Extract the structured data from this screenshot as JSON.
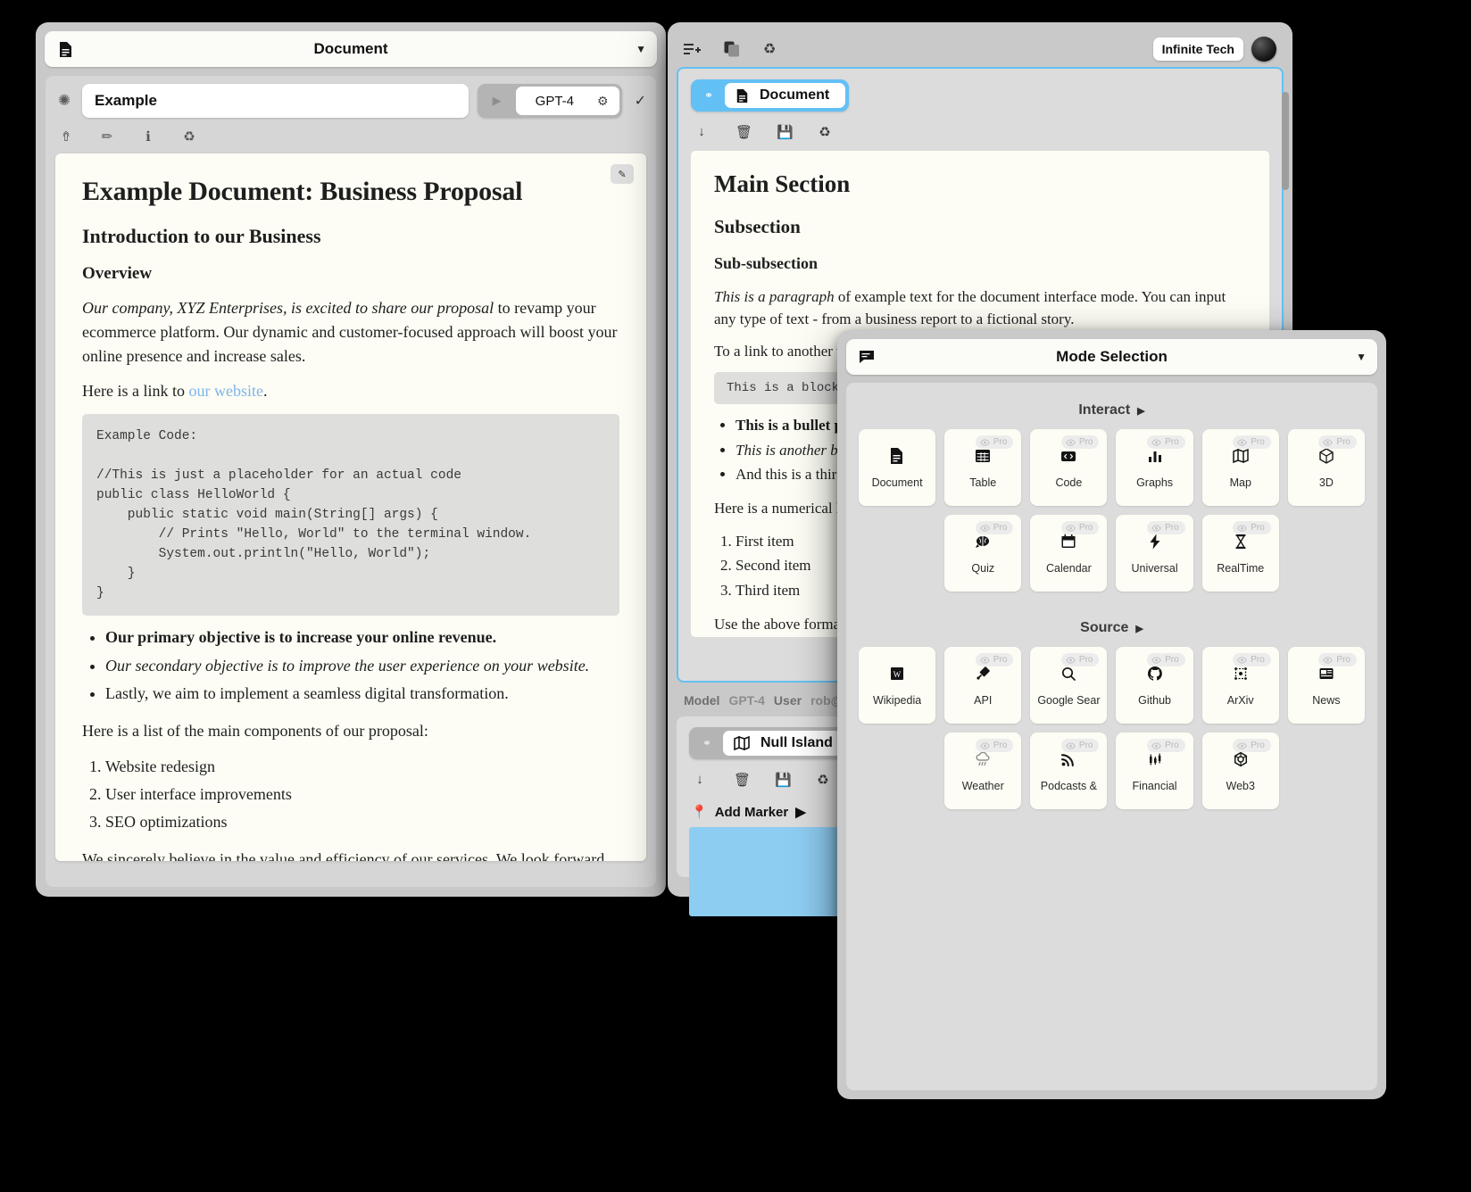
{
  "left_window": {
    "titlebar": {
      "title": "Document",
      "icon": "document-icon",
      "caret": "▼"
    },
    "name_field": {
      "value": "Example"
    },
    "model_selector": {
      "label": "GPT-4",
      "play": "▶",
      "gear": "⚙",
      "confirm": "✓"
    },
    "toolbar_icons": [
      "upload-icon",
      "pencil-icon",
      "info-icon",
      "recycle-icon"
    ],
    "document": {
      "edit_button": "✎",
      "title": "Example Document: Business Proposal",
      "h2": "Introduction to our Business",
      "h3": "Overview",
      "para1_em": "Our company, XYZ Enterprises, is excited to share our proposal",
      "para1_rest": " to revamp your ecommerce platform. Our dynamic and customer-focused approach will boost your online presence and increase sales.",
      "link_lead": "Here is a link to ",
      "link_text": "our website",
      "link_tail": ".",
      "code": "Example Code:\n\n//This is just a placeholder for an actual code\npublic class HelloWorld {\n    public static void main(String[] args) {\n        // Prints \"Hello, World\" to the terminal window.\n        System.out.println(\"Hello, World\");\n    }\n}",
      "bullets": [
        "Our primary objective is to increase your online revenue.",
        "Our secondary objective is to improve the user experience on your website.",
        "Lastly, we aim to implement a seamless digital transformation."
      ],
      "list_intro": "Here is a list of the main components of our proposal:",
      "numbered": [
        "Website redesign",
        "User interface improvements",
        "SEO optimizations"
      ],
      "closing": "We sincerely believe in the value and efficiency of our services. We look forward to the opportunity to work with you and elevate your online business."
    }
  },
  "right_window": {
    "toolbar_icons": [
      "add-list-icon",
      "copy-icon",
      "recycle-icon"
    ],
    "brand": {
      "name": "Infinite Tech",
      "avatar": "user-avatar"
    },
    "tab": {
      "label": "Document",
      "icon": "document-icon",
      "grip": "grip-handle"
    },
    "panel_icons": [
      "download-icon",
      "trash-icon",
      "save-icon",
      "recycle-icon"
    ],
    "document": {
      "h1": "Main Section",
      "h2": "Subsection",
      "h3": "Sub-subsection",
      "para1_em": "This is a paragraph",
      "para1_rest": " of example text for the document interface mode. You can input any type of text - from a business report to a fictional story.",
      "para2_lead": "To a ",
      "para2_link": "link",
      "para2_tail": " to another we",
      "code": "This is a block of",
      "bullets": [
        "This is a bullet point",
        "This is another bulle",
        "And this is a third on"
      ],
      "list_intro": "Here is a numerical lis",
      "numbered": [
        "First item",
        "Second item",
        "Third item"
      ],
      "closing": "Use the above format t"
    },
    "status": {
      "model_key": "Model",
      "model_value": "GPT-4",
      "user_key": "User",
      "user_value": "rob@....co"
    },
    "map_widget": {
      "tab_label": "Null Island",
      "tab_icon": "map-icon",
      "icons": [
        "download-icon",
        "trash-icon",
        "save-icon",
        "recycle-icon"
      ],
      "add_marker_label": "Add Marker",
      "add_marker_icon": "pin-icon",
      "add_marker_caret": "▶"
    }
  },
  "mode_window": {
    "titlebar": {
      "title": "Mode Selection",
      "icon": "chat-icon",
      "caret": "▼"
    },
    "pro_badge_label": "Pro",
    "sections": [
      {
        "name": "Interact",
        "caret": "▶",
        "cards": [
          {
            "label": "Document",
            "icon": "document-icon",
            "pro": false
          },
          {
            "label": "Table",
            "icon": "table-icon",
            "pro": true
          },
          {
            "label": "Code",
            "icon": "code-icon",
            "pro": true
          },
          {
            "label": "Graphs",
            "icon": "bar-chart-icon",
            "pro": true
          },
          {
            "label": "Map",
            "icon": "map-icon",
            "pro": true
          },
          {
            "label": "3D",
            "icon": "cube-icon",
            "pro": true
          },
          {
            "label": "",
            "icon": "",
            "pro": false,
            "empty": true
          },
          {
            "label": "Quiz",
            "icon": "brain-icon",
            "pro": true
          },
          {
            "label": "Calendar",
            "icon": "calendar-icon",
            "pro": true
          },
          {
            "label": "Universal",
            "icon": "lightning-icon",
            "pro": true
          },
          {
            "label": "RealTime",
            "icon": "hourglass-icon",
            "pro": true
          },
          {
            "label": "",
            "icon": "",
            "pro": false,
            "empty": true
          }
        ]
      },
      {
        "name": "Source",
        "caret": "▶",
        "cards": [
          {
            "label": "Wikipedia",
            "icon": "wikipedia-icon",
            "pro": false
          },
          {
            "label": "API",
            "icon": "plug-icon",
            "pro": true
          },
          {
            "label": "Google Sear",
            "icon": "search-icon",
            "pro": true
          },
          {
            "label": "Github",
            "icon": "github-icon",
            "pro": true
          },
          {
            "label": "ArXiv",
            "icon": "arxiv-icon",
            "pro": true
          },
          {
            "label": "News",
            "icon": "news-icon",
            "pro": true
          },
          {
            "label": "",
            "icon": "",
            "pro": false,
            "empty": true
          },
          {
            "label": "Weather",
            "icon": "cloud-rain-icon",
            "pro": true
          },
          {
            "label": "Podcasts & ",
            "icon": "rss-icon",
            "pro": true
          },
          {
            "label": "Financial",
            "icon": "candlestick-icon",
            "pro": true
          },
          {
            "label": "Web3",
            "icon": "web3-icon",
            "pro": true
          },
          {
            "label": "",
            "icon": "",
            "pro": false,
            "empty": true
          }
        ]
      }
    ]
  }
}
